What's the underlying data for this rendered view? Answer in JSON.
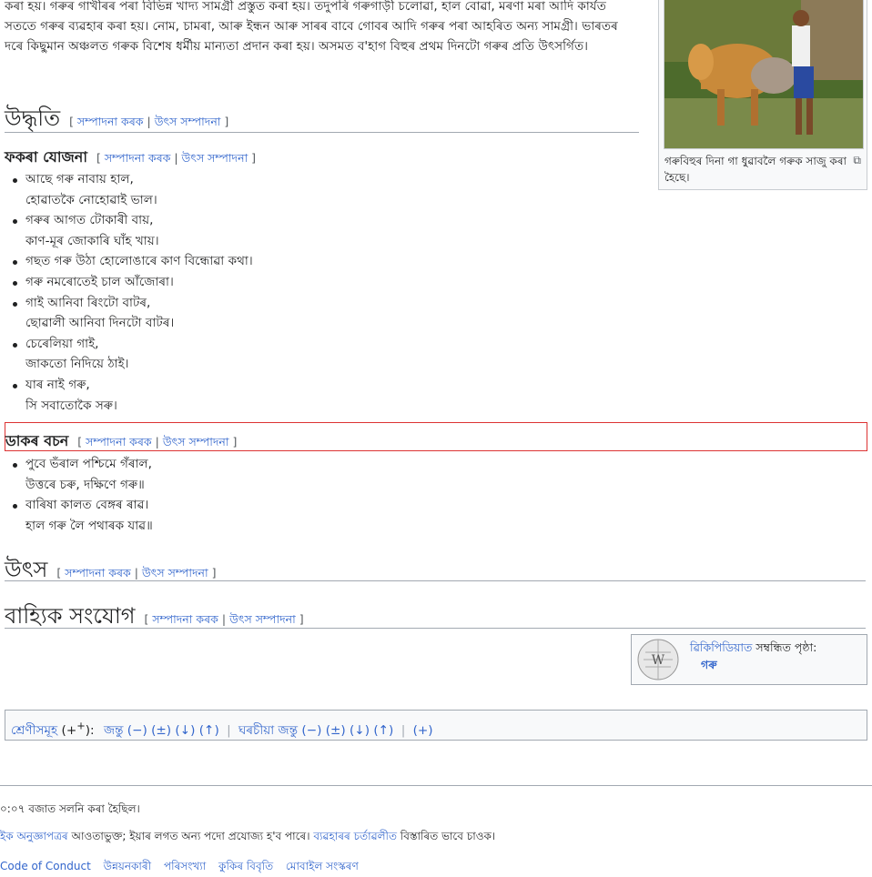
{
  "intro": {
    "text_plain1": "কৰা হয়। গৰুৰ গাখীৰৰ পৰা বিভিন্ন খাদ্য সামগ্ৰী প্ৰস্তুত কৰা হয়। তদুপৰি গৰুগাড়ী চলোৱা, হাল বোৱা, মৰণা মৰা আদি কাৰ্যত সততে গৰুৰ ব্যৱহাৰ কৰা হয়। নোম, চামৰা, আৰু ইন্ধন আৰু সাৰৰ বাবে গোবৰ আদি গৰুৰ পৰা আহৰিত অন্য সামগ্ৰী। ভাৰতৰ দৰে কিছুমান অঞ্চলত গৰুক বিশেষ ধৰ্মীয় মান্যতা প্ৰদান কৰা হয়। অসমত ব'হাগ বিহুৰ প্ৰথম দিনটো গৰুৰ প্ৰতি উৎসৰ্গিত।"
  },
  "thumb": {
    "caption": "গৰুবিহুৰ দিনা গা ধুৱাবলৈ গৰুক সাজু কৰা হৈছে।"
  },
  "edit_links": {
    "edit": "সম্পাদনা কৰক",
    "source_edit": "উৎস সম্পাদনা"
  },
  "sections": {
    "quotes": "উদ্ধৃতি",
    "proverbs": "ফকৰা যোজনা",
    "dak": "ডাকৰ বচন",
    "sources": "উৎস",
    "external": "বাহ্যিক সংযোগ"
  },
  "proverbs": [
    {
      "l1": "আছে গৰু নাবায় হাল,",
      "l2": "হোৱাতকৈ নোহোৱাই ভাল।"
    },
    {
      "l1": "গৰুৰ আগত টোকাৰী বায়,",
      "l2": "কাণ-মূৰ জোকাৰি ঘাঁহ খায়।"
    },
    {
      "l1": "গছত গৰু উঠা হোলোঙাৰে কাণ বিন্ধোৱা কথা।",
      "l2": ""
    },
    {
      "l1": "গৰু নমৰোতেই চাল আঁজোৰা।",
      "l2": ""
    },
    {
      "l1": "গাই আনিবা ৰিংটো বাটৰ,",
      "l2": "ছোৱালী আনিবা দিনটো বাটৰ।"
    },
    {
      "l1": "চেৰেলিয়া গাই,",
      "l2": "জাকতো নিদিয়ে ঠাই।"
    },
    {
      "l1": "যাৰ নাই গৰু,",
      "l2": "সি সবাতোকৈ সৰু।"
    }
  ],
  "dak": [
    {
      "l1": "পুবে ভঁৰাল পশ্চিমে গঁৰাল,",
      "l2": "উত্তৰে চৰু, দক্ষিণে গৰু॥"
    },
    {
      "l1": "বাৰিষা কালত বেঙ্গৰ ৰাৱ।",
      "l2": "হাল গৰু লৈ পথাৰক যাৱ॥"
    }
  ],
  "sister": {
    "link": "ৱিকিপিডিয়াত",
    "text": "সম্বন্ধিত পৃষ্ঠা:",
    "page": "গৰু"
  },
  "categories": {
    "label": "শ্ৰেণীসমূহ",
    "plus": "(+",
    "sup": "+",
    "close": "):",
    "cat1": "জন্তু",
    "cat2": "ঘৰচীয়া জন্তু",
    "ops": "(−) (±) (↓) (↑)",
    "add": "(+)"
  },
  "footer": {
    "modified": "০:০৭ বজাত সলনি কৰা হৈছিল।",
    "license_link": "ইক অনুজ্ঞাপত্ৰৰ",
    "license_text1": " আওতাভুক্ত; ইয়াৰ লগত অন্য পদো প্ৰযোজ্য হ'ব পাৰে। ",
    "terms_link": "ব্যৱহাৰৰ চৰ্তাৱলীত",
    "license_text2": " বিস্তাৰিত ভাবে চাওক।",
    "links": [
      "Code of Conduct",
      "উন্নয়নকাৰী",
      "পৰিসংখ্যা",
      "কুকিৰ বিবৃতি",
      "মোবাইল সংস্কৰণ"
    ]
  },
  "colors": {
    "link": "#3366cc",
    "highlight_border": "#d33"
  }
}
